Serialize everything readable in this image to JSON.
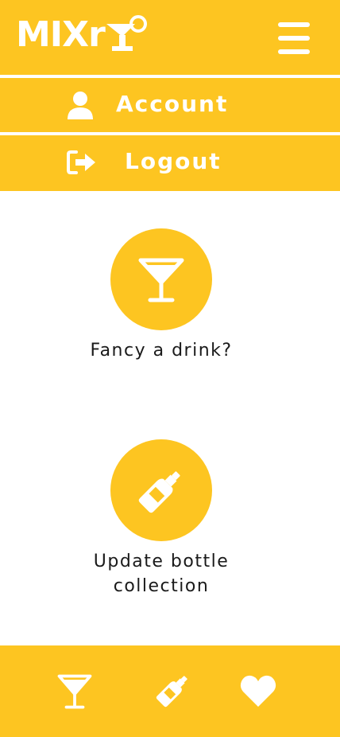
{
  "app": {
    "logo_text": "MIXr"
  },
  "menu": {
    "items": [
      {
        "label": "Account",
        "icon": "user-icon"
      },
      {
        "label": "Logout",
        "icon": "logout-icon"
      }
    ]
  },
  "main": {
    "cards": [
      {
        "label": "Fancy a drink?",
        "icon": "cocktail-glass-icon"
      },
      {
        "label": "Update bottle collection",
        "icon": "bottle-icon"
      }
    ]
  },
  "bottom_nav": {
    "items": [
      {
        "icon": "cocktail-glass-icon"
      },
      {
        "icon": "bottle-icon"
      },
      {
        "icon": "heart-icon"
      }
    ]
  },
  "colors": {
    "accent": "#FDC521",
    "text_on_accent": "#FFFFFF",
    "body_text": "#1A1A1A"
  }
}
